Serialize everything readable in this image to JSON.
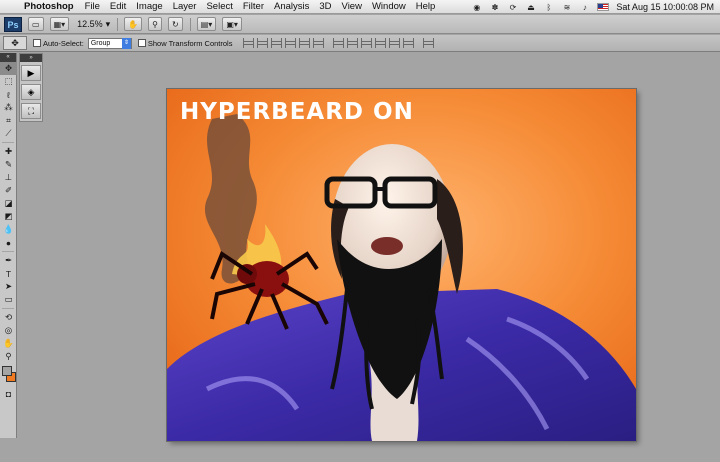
{
  "menubar": {
    "app_name": "Photoshop",
    "items": [
      "File",
      "Edit",
      "Image",
      "Layer",
      "Select",
      "Filter",
      "Analysis",
      "3D",
      "View",
      "Window",
      "Help"
    ],
    "clock": "Sat Aug 15  10:00:08 PM"
  },
  "appbar": {
    "logo": "Ps",
    "zoom": "12.5%"
  },
  "options": {
    "auto_select_label": "Auto-Select:",
    "auto_select_value": "Group",
    "transform_label": "Show Transform Controls"
  },
  "canvas": {
    "overlay_text": "HYPERBEARD ON"
  },
  "colors": {
    "foreground": "#a4a4a4",
    "background": "#f07a22",
    "canvas_orange": "#f27d2a"
  }
}
